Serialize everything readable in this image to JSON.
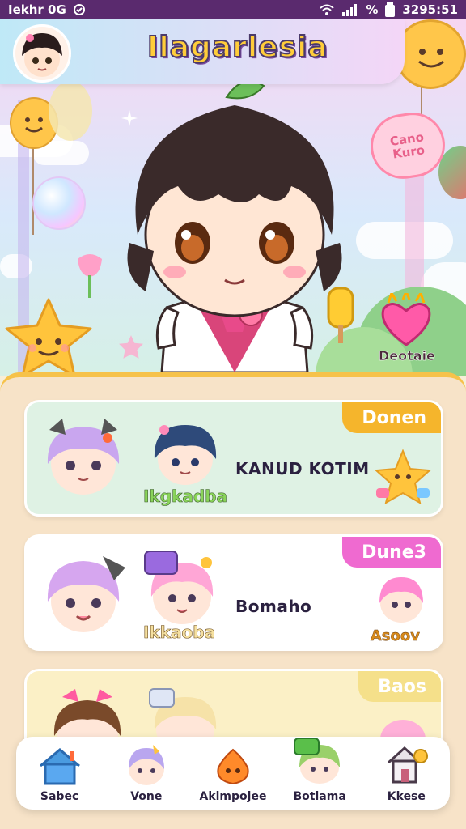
{
  "status_bar": {
    "carrier": "Iekhr 0G",
    "battery_percent_glyph": "%",
    "time": "3295:51"
  },
  "header": {
    "app_title": "Ilagarlesia"
  },
  "hero": {
    "speech_bubble": "Cano Kuro",
    "decor_label": "Deotaie"
  },
  "cards": [
    {
      "tag": "Donen",
      "title": "KANUD KOTIM",
      "subtitle": "Ikgkadba",
      "extra": "",
      "tag_color": "#f5b52c",
      "bg": "#dff2e4"
    },
    {
      "tag": "Dune3",
      "title": "Bomaho",
      "subtitle": "Ikkaoba",
      "extra": "Asoov",
      "tag_color": "#ef6ad0",
      "bg": "#ffffff"
    },
    {
      "tag": "Baos",
      "title": "",
      "subtitle": "",
      "extra": "",
      "tag_color": "#f5e08a",
      "bg": "#fbf0c6"
    }
  ],
  "nav": [
    {
      "label": "Sabec",
      "icon": "home-icon"
    },
    {
      "label": "Vone",
      "icon": "chibi-purple-icon"
    },
    {
      "label": "Aklmpojee",
      "icon": "fire-face-icon"
    },
    {
      "label": "Botiama",
      "icon": "green-chibi-icon"
    },
    {
      "label": "Kkese",
      "icon": "shop-house-icon"
    }
  ]
}
